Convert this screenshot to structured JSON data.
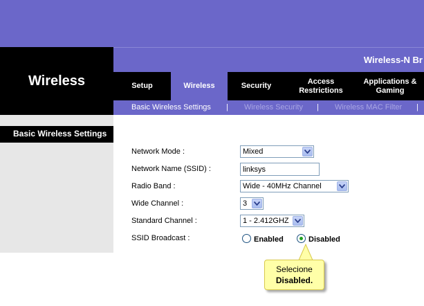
{
  "section_title": "Wireless",
  "product_name": "Wireless-N Br",
  "tabs": [
    {
      "label": "Setup"
    },
    {
      "label": "Wireless",
      "active": true
    },
    {
      "label": "Security"
    },
    {
      "label": "Access Restrictions"
    },
    {
      "label": "Applications & Gaming"
    }
  ],
  "subtabs": [
    {
      "label": "Basic Wireless Settings",
      "active": true
    },
    {
      "label": "Wireless Security"
    },
    {
      "label": "Wireless MAC Filter"
    }
  ],
  "subtab_separator": "|",
  "left_header": "Basic Wireless Settings",
  "form": {
    "network_mode": {
      "label": "Network Mode :",
      "value": "Mixed"
    },
    "ssid": {
      "label": "Network Name (SSID) :",
      "value": "linksys"
    },
    "radio_band": {
      "label": "Radio Band :",
      "value": "Wide - 40MHz Channel"
    },
    "wide_channel": {
      "label": "Wide Channel :",
      "value": "3"
    },
    "standard_channel": {
      "label": "Standard Channel :",
      "value": "1 - 2.412GHZ"
    },
    "ssid_broadcast": {
      "label": "SSID Broadcast :",
      "options": [
        "Enabled",
        "Disabled"
      ],
      "selected": "Disabled"
    }
  },
  "callout": {
    "line1": "Selecione",
    "line2": "Disabled."
  },
  "colors": {
    "brand": "#6b67c9",
    "callout_bg": "#ffffa8",
    "radio_dot": "#21a121"
  }
}
